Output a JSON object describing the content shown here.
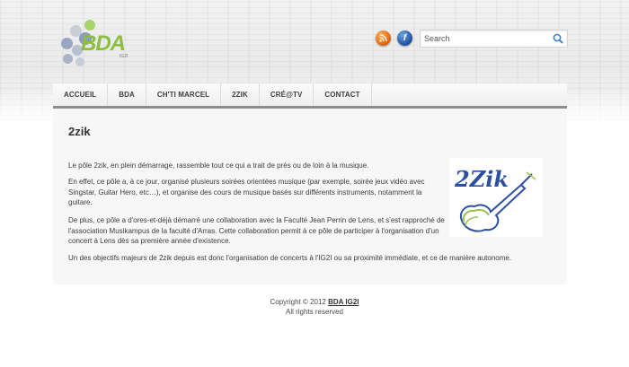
{
  "header": {
    "logo_text": "BDA",
    "logo_sub": "IG2I",
    "search": {
      "placeholder": "Search"
    },
    "icons": {
      "rss": "rss-icon",
      "facebook": "facebook-icon",
      "search": "magnifier-icon"
    }
  },
  "nav": {
    "items": [
      "ACCUEIL",
      "BDA",
      "CH'TI MARCEL",
      "2ZIK",
      "CRÉ@TV",
      "CONTACT"
    ]
  },
  "main": {
    "title": "2zik",
    "paragraphs": [
      "Le pôle 2zik, en plein démarrage, rassemble tout ce qui a trait de près ou de loin à la musique.",
      "En effet, ce pôle a, à ce jour, organisé plusieurs soirées orientées musique (par exemple, soirée jeux vidéo avec Singstar, Guitar Hero, etc…), et organise des cours de musique basés sur différents instruments, notamment la guitare.",
      "De plus, ce pôle a d'ores-et-déjà démarré une collaboration avec la Faculté Jean Perrin de Lens, et s'est rapproché de l'association Musikampus de la faculté d'Arras. Cette collaboration permit à ce pôle de participer à l'organisation d'un concert à Lens dès sa première année d'existence.",
      "Un des objectifs majeurs de 2zik depuis est donc l'organisation de concerts à l'IG2I ou sa proximité immédiate, et ce de manière autonome."
    ],
    "image_text": "2Zik"
  },
  "footer": {
    "copyright": "Copyright © 2012",
    "link": "BDA IG2I",
    "rights": "All rights reserved"
  },
  "colors": {
    "logo_green": "#8cbf3f",
    "nav_border": "#8d8d8d",
    "content_bg": "#f7f7f7",
    "image_blue": "#2b4fa3"
  }
}
